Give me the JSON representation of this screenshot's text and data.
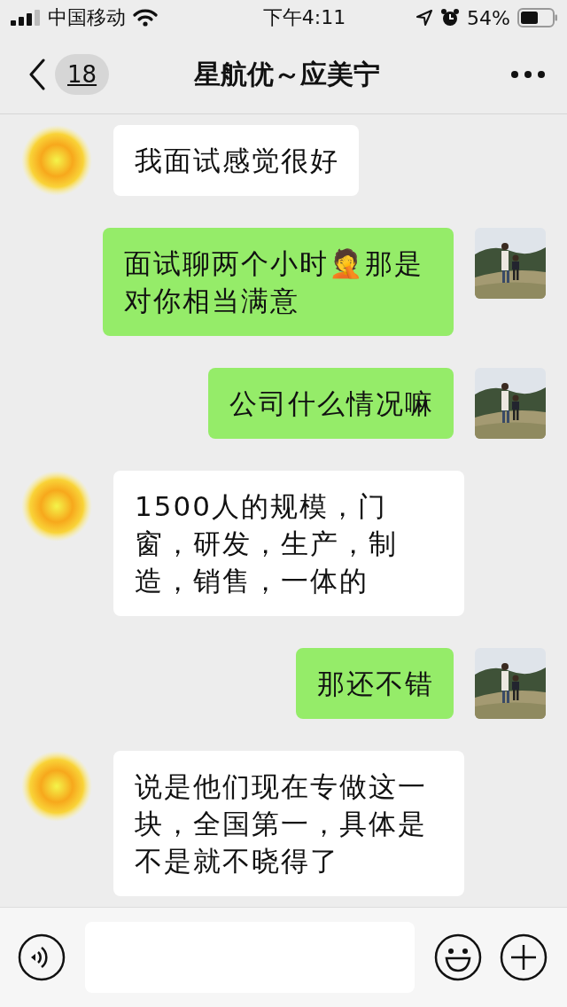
{
  "status_bar": {
    "carrier": "中国移动",
    "time": "下午4:11",
    "battery": "54%"
  },
  "nav": {
    "back_count": "18",
    "title": "星航优～应美宁"
  },
  "messages": [
    {
      "kind": "incoming",
      "text": "我面试感觉很好"
    },
    {
      "kind": "outgoing",
      "text": "面试聊两个小时🤦那是对你相当满意"
    },
    {
      "kind": "outgoing",
      "text": "公司什么情况嘛"
    },
    {
      "kind": "incoming",
      "text": "1500人的规模，门窗，研发，生产，制造，销售，一体的"
    },
    {
      "kind": "outgoing",
      "text": "那还不错"
    },
    {
      "kind": "incoming",
      "text": "说是他们现在专做这一块，全国第一，具体是不是就不晓得了"
    }
  ]
}
